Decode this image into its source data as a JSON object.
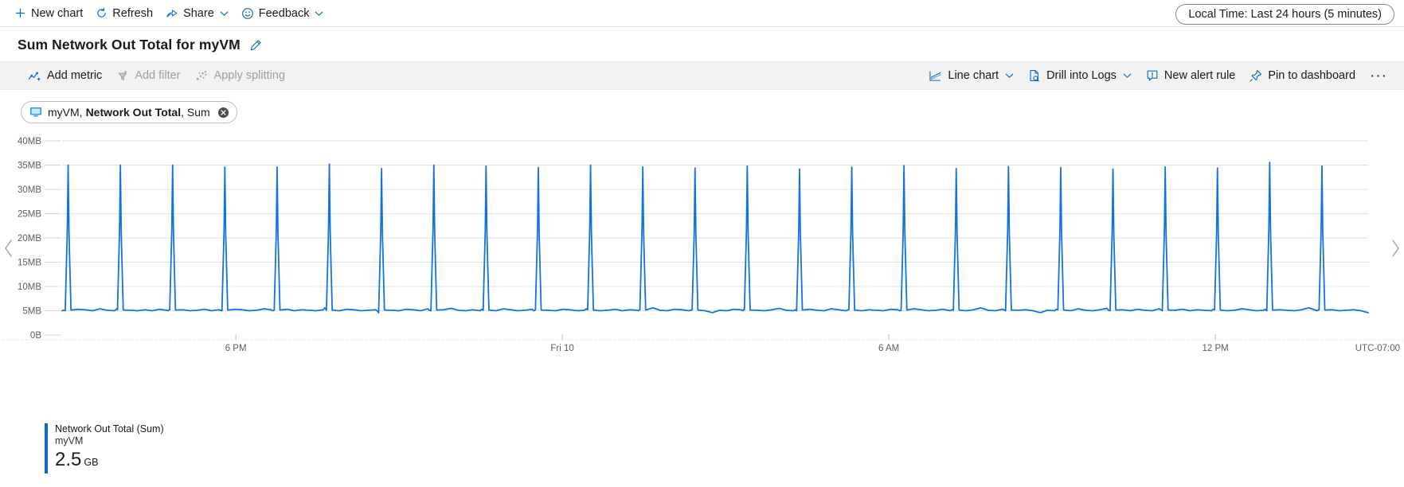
{
  "commandbar": {
    "new_chart": "New chart",
    "refresh": "Refresh",
    "share": "Share",
    "feedback": "Feedback",
    "time_range": "Local Time: Last 24 hours (5 minutes)"
  },
  "title": {
    "text": "Sum Network Out Total for myVM",
    "edit_icon": "pencil-icon"
  },
  "chart_toolbar": {
    "add_metric": "Add metric",
    "add_filter": "Add filter",
    "apply_splitting": "Apply splitting",
    "chart_type": "Line chart",
    "drill_into_logs": "Drill into Logs",
    "new_alert_rule": "New alert rule",
    "pin_to_dashboard": "Pin to dashboard",
    "more": "···"
  },
  "metric_pill": {
    "resource": "myVM,",
    "metric": "Network Out Total",
    "aggregation": ", Sum",
    "icon": "vm-icon",
    "close_icon": "close-circle-icon"
  },
  "legend": {
    "series_name": "Network Out Total (Sum)",
    "resource": "myVM",
    "value": "2.5",
    "unit": "GB",
    "color": "#0f6cbd"
  },
  "colors": {
    "accent": "#0f6cbd",
    "line": "#1273de",
    "toolbar_bg": "#f2f2f2",
    "grid": "#e1e1e1",
    "disabled_text": "#a19f9d"
  },
  "chart_data": {
    "type": "line",
    "title": "Sum Network Out Total for myVM",
    "xlabel": "",
    "ylabel": "",
    "ylim": [
      0,
      40
    ],
    "yunit": "MB",
    "ytick_labels": [
      "40MB",
      "35MB",
      "30MB",
      "25MB",
      "20MB",
      "15MB",
      "10MB",
      "5MB",
      "0B"
    ],
    "ytick_values": [
      40,
      35,
      30,
      25,
      20,
      15,
      10,
      5,
      0
    ],
    "xtick_labels": [
      "6 PM",
      "Fri 10",
      "6 AM",
      "12 PM"
    ],
    "xtick_positions": [
      0.133,
      0.383,
      0.633,
      0.883
    ],
    "timezone_label": "UTC-07:00",
    "grid": true,
    "legend_position": "bottom-left",
    "series": [
      {
        "name": "Network Out Total (Sum)",
        "resource": "myVM",
        "color": "#1273de",
        "total": "2.5 GB",
        "baseline_mb": 5.0,
        "spike_peak_mb": 35.0,
        "spike_count": 25,
        "spike_peaks_mb": [
          35.0,
          35.0,
          35.0,
          34.6,
          34.6,
          35.2,
          34.3,
          35.0,
          34.8,
          34.5,
          35.0,
          34.6,
          34.4,
          34.8,
          34.2,
          34.6,
          34.9,
          34.3,
          34.7,
          34.5,
          34.2,
          34.6,
          34.4,
          35.6,
          34.8
        ],
        "baseline_samples_mb": [
          5.1,
          5.0,
          5.3,
          5.2,
          5.0,
          5.4,
          5.1,
          5.0,
          5.2,
          5.5,
          5.1,
          5.0,
          5.2,
          5.0,
          5.3,
          5.1,
          5.0,
          5.4,
          5.2,
          5.0,
          5.1,
          5.3,
          5.0,
          5.2,
          5.1,
          5.0,
          5.3,
          5.2,
          5.0,
          5.1,
          5.4,
          5.2,
          5.0,
          5.1,
          5.3,
          5.0,
          5.2,
          5.1,
          5.0,
          5.2,
          5.6,
          5.1,
          5.0,
          5.3,
          5.2,
          5.0,
          5.1,
          5.2,
          5.0,
          4.6
        ]
      }
    ]
  },
  "nav": {
    "prev_icon": "chevron-left-icon",
    "next_icon": "chevron-right-icon"
  }
}
